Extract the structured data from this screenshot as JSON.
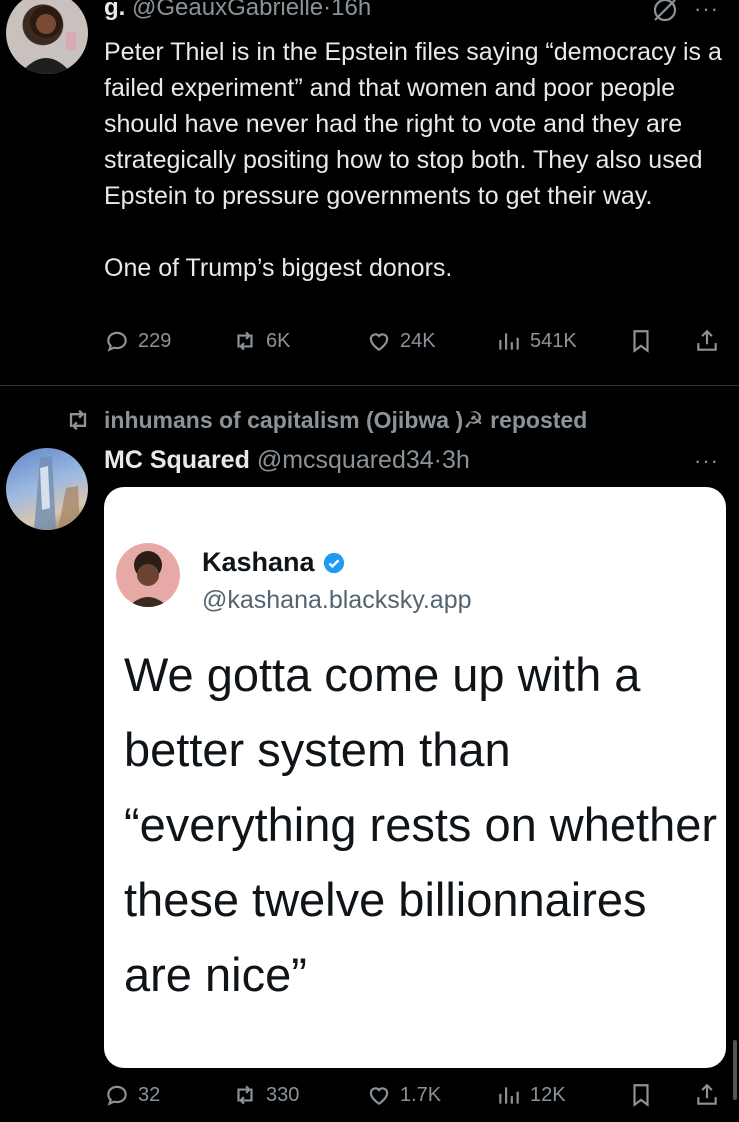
{
  "tweet1": {
    "display_name": "g.",
    "handle": "@GeauxGabrielle",
    "separator": "·",
    "time": "16h",
    "paragraph1": "Peter Thiel is in the Epstein files saying “democracy is a failed experiment” and that women and poor people should have never had the right to vote and they are strategically positing how to stop both. They also used Epstein to pressure governments to get their way.",
    "paragraph2": "One of Trump’s biggest donors.",
    "replies": "229",
    "reposts": "6K",
    "likes": "24K",
    "views": "541K",
    "more": "···"
  },
  "repost_banner": {
    "text": "inhumans of capitalism (Ojibwa )☭ reposted"
  },
  "tweet2": {
    "display_name": "MC Squared",
    "handle": "@mcsquared34",
    "separator": "·",
    "time": "3h",
    "more": "···",
    "embedded": {
      "name": "Kashana",
      "handle": "@kashana.blacksky.app",
      "text": "We gotta come up with a better system than “everything rests on whether these twelve billionnaires are nice”"
    },
    "replies": "32",
    "reposts": "330",
    "likes": "1.7K",
    "views": "12K"
  },
  "colors": {
    "background": "#000000",
    "text": "#e7e9ea",
    "muted": "#8b9399",
    "verified": "#1d9bf0"
  },
  "icons": [
    "reply-icon",
    "repost-icon",
    "like-icon",
    "views-icon",
    "bookmark-icon",
    "share-icon",
    "grok-icon",
    "verified-icon"
  ]
}
